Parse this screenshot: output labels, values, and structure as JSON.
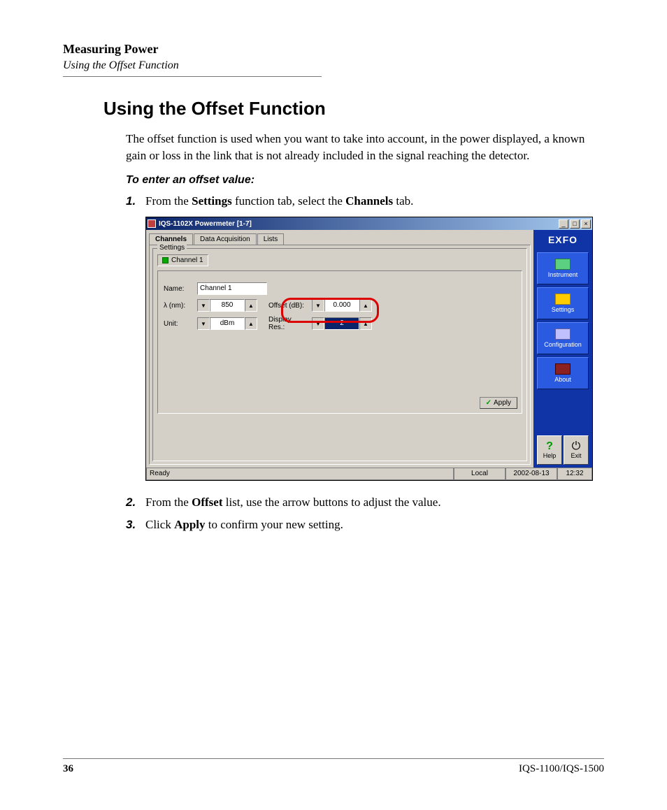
{
  "header": {
    "chapter": "Measuring Power",
    "section": "Using the Offset Function"
  },
  "title": "Using the Offset Function",
  "intro": "The offset function is used when you want to take into account, in the power displayed, a known gain or loss in the link that is not already included in the signal reaching the detector.",
  "subhead": "To enter an offset value:",
  "steps": {
    "s1": {
      "num": "1.",
      "pre": "From the ",
      "b1": "Settings",
      "mid": " function tab, select the ",
      "b2": "Channels",
      "post": " tab."
    },
    "s2": {
      "num": "2.",
      "pre": "From the ",
      "b1": "Offset",
      "post": " list, use the arrow buttons to adjust the value."
    },
    "s3": {
      "num": "3.",
      "pre": "Click ",
      "b1": "Apply",
      "post": " to confirm your new setting."
    }
  },
  "window": {
    "title": "IQS-1102X Powermeter [1-7]",
    "tabs": {
      "channels": "Channels",
      "data_acq": "Data Acquisition",
      "lists": "Lists"
    },
    "group_legend": "Settings",
    "channel_button": "Channel 1",
    "name_label": "Name:",
    "name_value": "Channel 1",
    "wavelength_label": "λ  (nm):",
    "wavelength_value": "850",
    "offset_label": "Offset (dB):",
    "offset_value": "0.000",
    "unit_label": "Unit:",
    "unit_value": "dBm",
    "display_res_label": "Display Res.:",
    "display_res_value": "2",
    "apply": "Apply",
    "logo": "EXFO",
    "nav": {
      "instrument": "Instrument",
      "settings": "Settings",
      "configuration": "Configuration",
      "about": "About"
    },
    "help": "Help",
    "exit": "Exit",
    "status": {
      "ready": "Ready",
      "local": "Local",
      "date": "2002-08-13",
      "time": "12:32"
    }
  },
  "footer": {
    "page": "36",
    "doc": "IQS-1100/IQS-1500"
  }
}
